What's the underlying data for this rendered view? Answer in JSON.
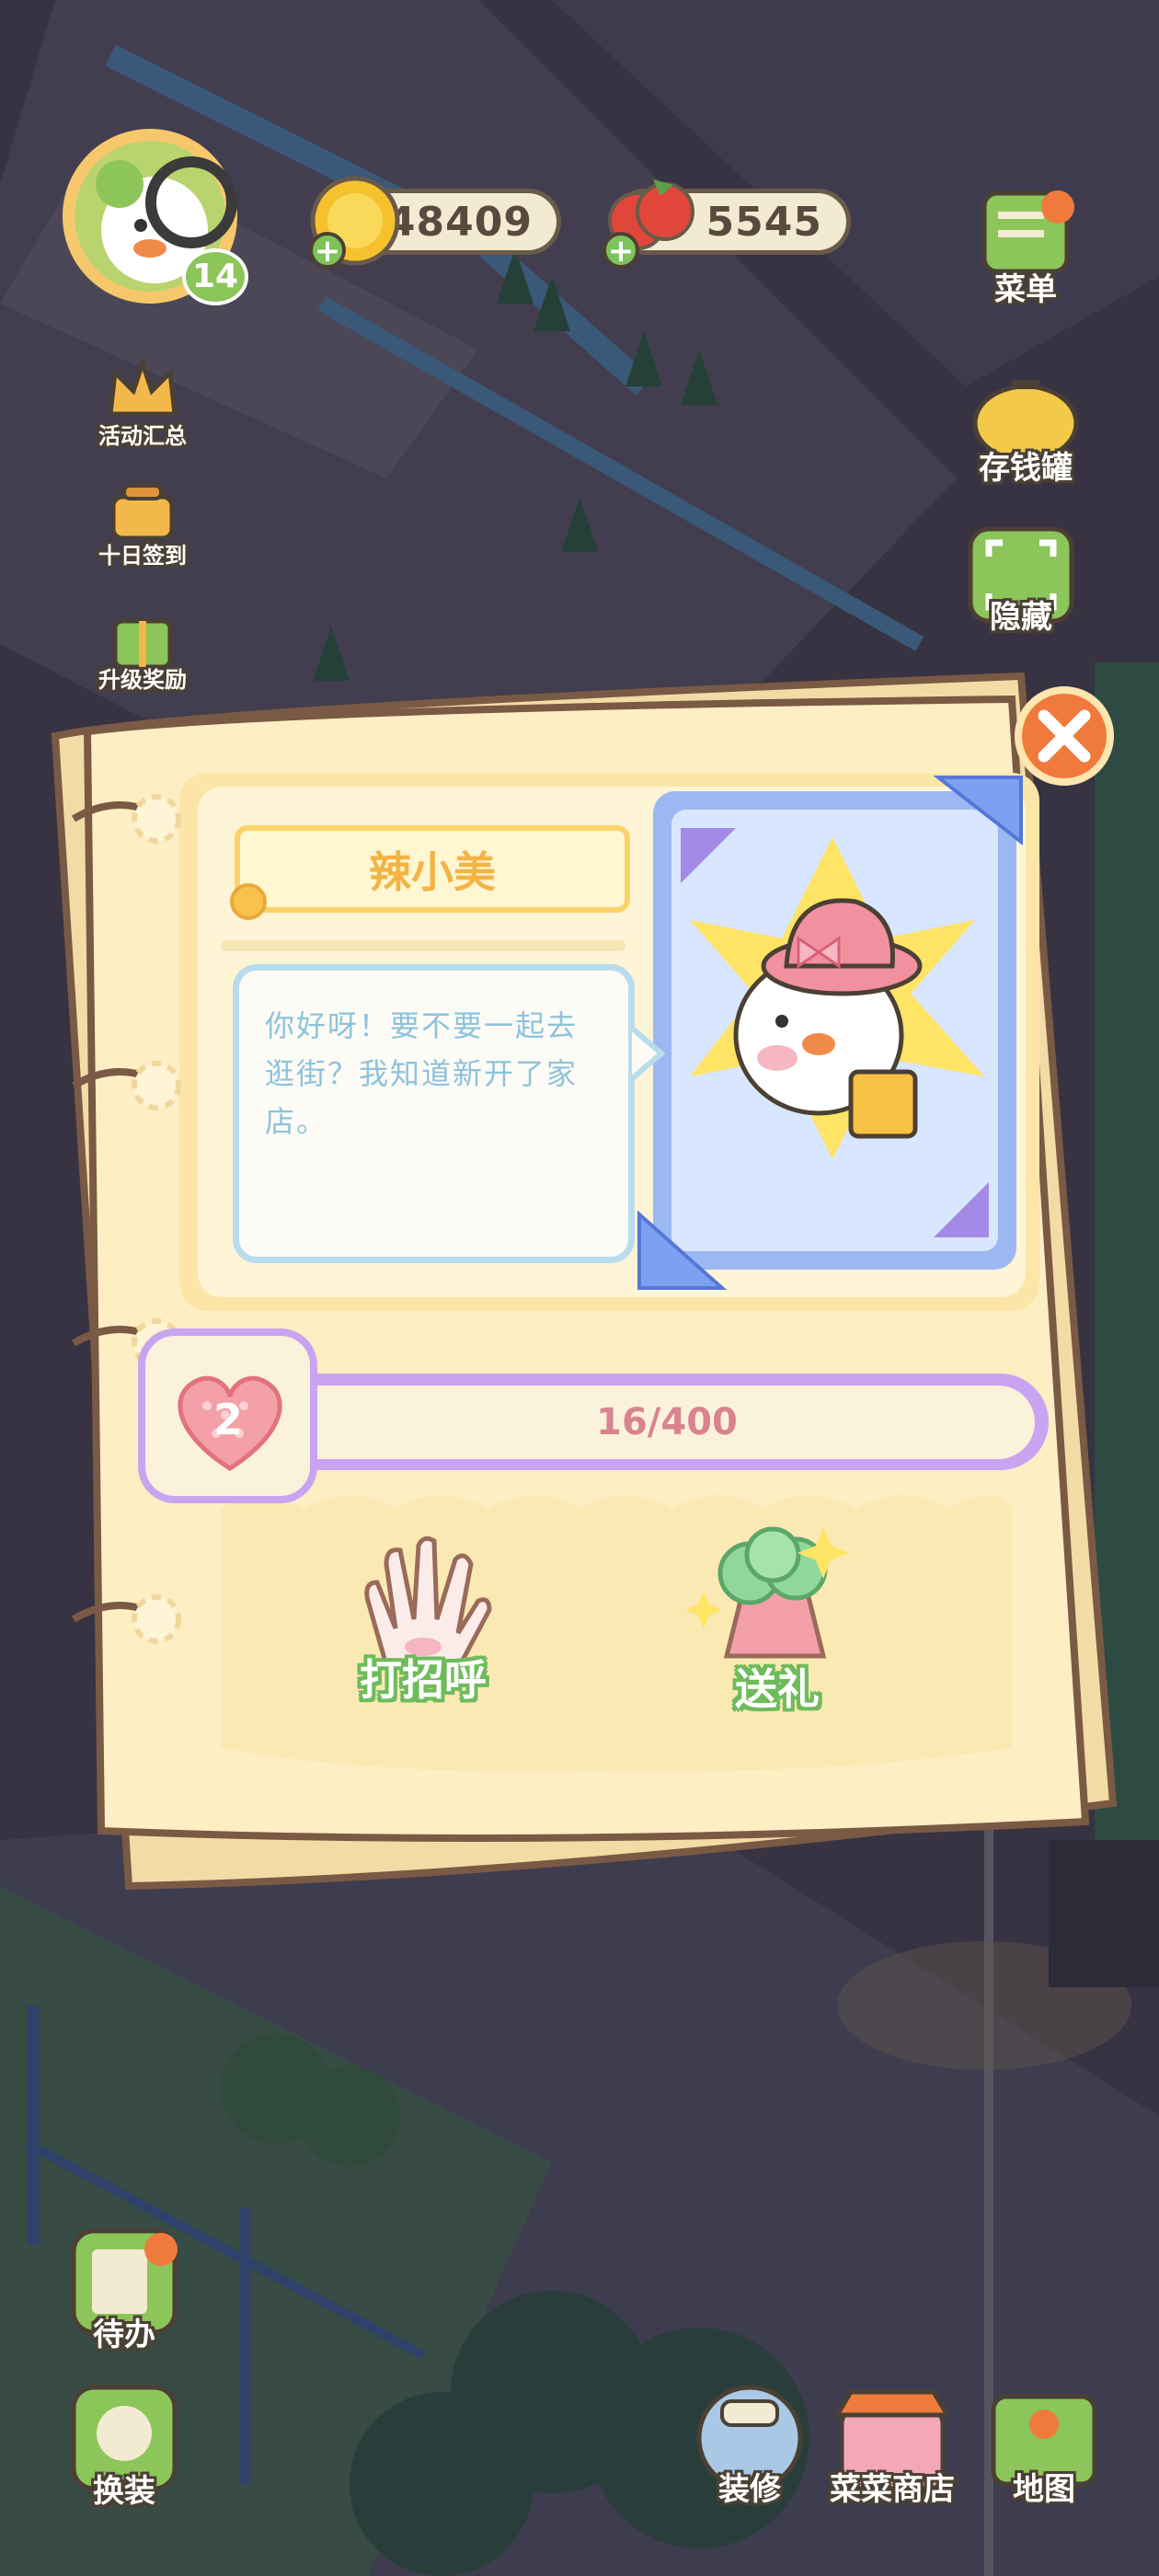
{
  "hud": {
    "level": "14",
    "coins": "48409",
    "tomatoes": "5545",
    "menu_label": "菜单",
    "piggy_label": "存钱罐",
    "hide_label": "隐藏",
    "events_label": "活动汇总",
    "signin_label": "十日签到",
    "upgrade_label": "升级奖励",
    "todo_label": "待办",
    "dress_label": "换装",
    "decorate_label": "装修",
    "shop_label": "菜菜商店",
    "map_label": "地图"
  },
  "dialog": {
    "npc_name": "辣小美",
    "speech": "你好呀！要不要一起去逛街？我知道新开了家店。",
    "affection_level": "2",
    "affection_progress": "16/400",
    "affection_fraction": 0.04,
    "greet_label": "打招呼",
    "gift_label": "送礼"
  },
  "colors": {
    "panel": "#fdeec4",
    "panel_border": "#7a5a44",
    "bar_purple": "#c9a4f0",
    "bar_text": "#d9838f",
    "action_green": "#6fbb5c",
    "close_orange": "#f07a3c"
  }
}
